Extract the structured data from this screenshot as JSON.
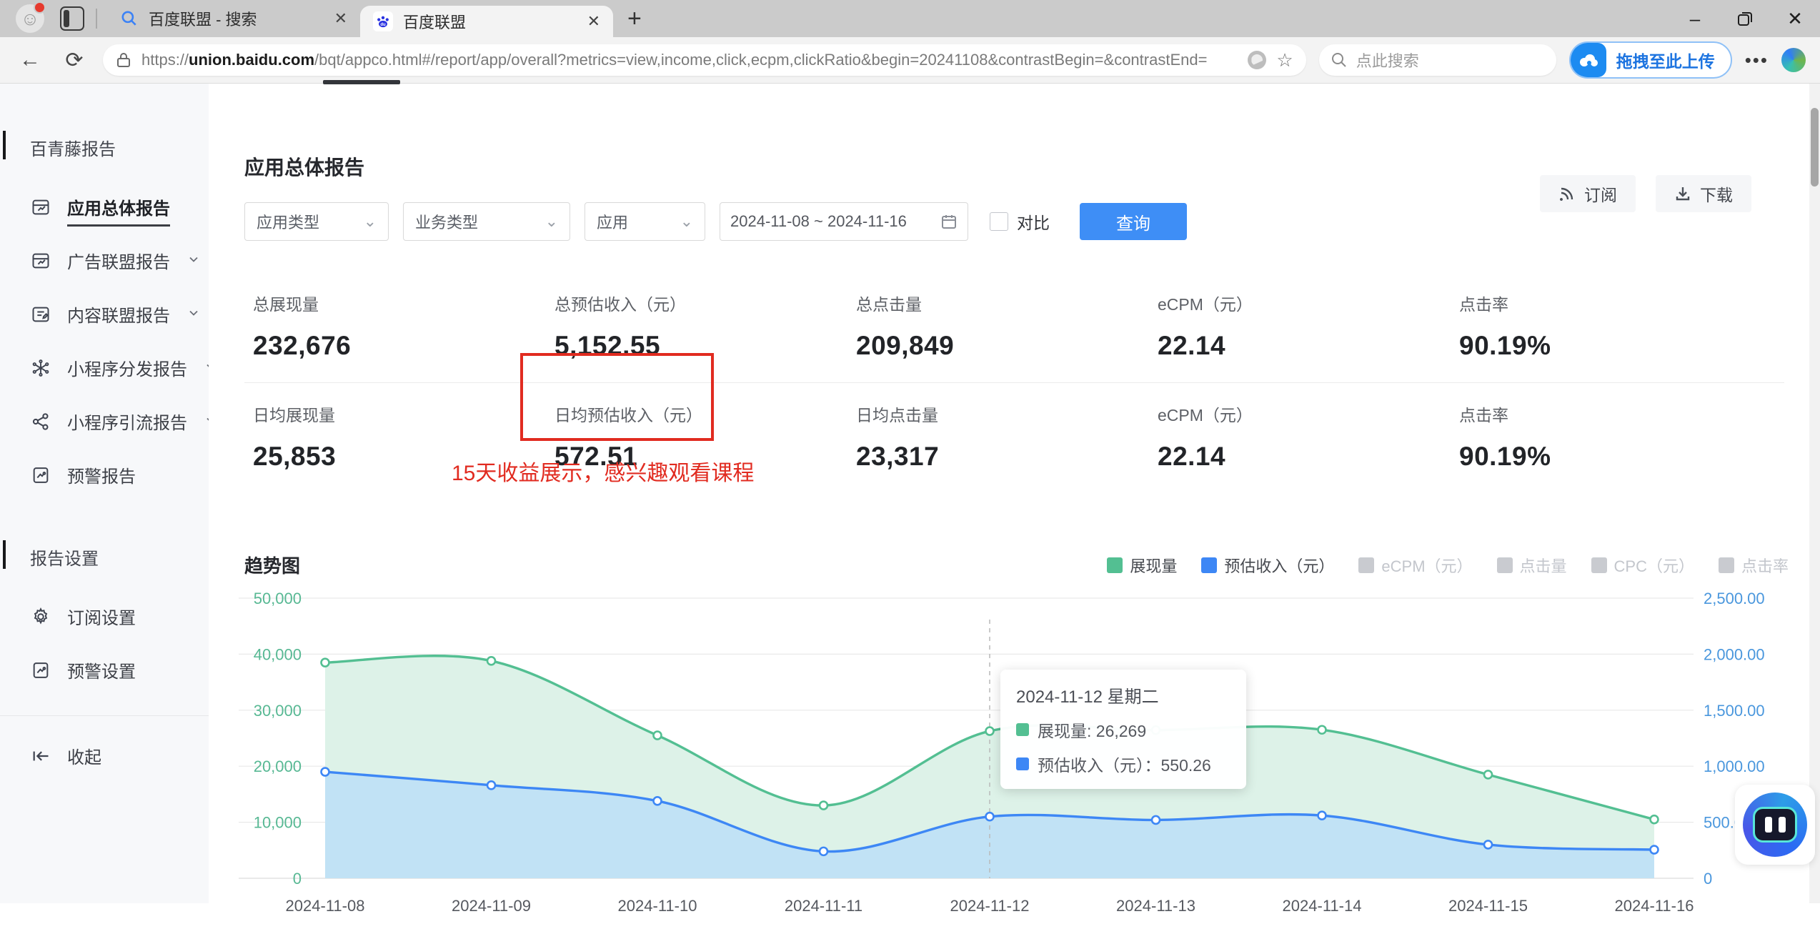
{
  "browser": {
    "tabs": [
      {
        "title": "百度联盟 - 搜索",
        "icon": "search-favicon",
        "active": false
      },
      {
        "title": "百度联盟",
        "icon": "baidu-favicon",
        "active": true
      }
    ],
    "url_prefix": "https://",
    "url_domain": "union.baidu.com",
    "url_path": "/bqt/appco.html#/report/app/overall?metrics=view,income,click,ecpm,clickRatio&begin=20241108&contrastBegin=&contrastEnd=",
    "search_placeholder": "点此搜索",
    "upload_button": "拖拽至此上传"
  },
  "sidebar": {
    "sections": [
      {
        "header": "百青藤报告",
        "items": [
          {
            "label": "应用总体报告",
            "icon": "report-icon",
            "active": true,
            "chevron": false
          },
          {
            "label": "广告联盟报告",
            "icon": "report-icon",
            "active": false,
            "chevron": true
          },
          {
            "label": "内容联盟报告",
            "icon": "content-icon",
            "active": false,
            "chevron": true
          },
          {
            "label": "小程序分发报告",
            "icon": "distribute-icon",
            "active": false,
            "chevron": true
          },
          {
            "label": "小程序引流报告",
            "icon": "share-icon",
            "active": false,
            "chevron": true
          },
          {
            "label": "预警报告",
            "icon": "alert-icon",
            "active": false,
            "chevron": false
          }
        ]
      },
      {
        "header": "报告设置",
        "items": [
          {
            "label": "订阅设置",
            "icon": "gear-icon",
            "active": false,
            "chevron": false
          },
          {
            "label": "预警设置",
            "icon": "alert-icon",
            "active": false,
            "chevron": false
          }
        ]
      }
    ],
    "collapse_label": "收起"
  },
  "page": {
    "title": "应用总体报告",
    "filters": {
      "app_type": "应用类型",
      "biz_type": "业务类型",
      "app": "应用",
      "date_range": "2024-11-08 ~ 2024-11-16",
      "compare_label": "对比",
      "query_button": "查询",
      "subscribe_button": "订阅",
      "download_button": "下载"
    },
    "stats_rows": [
      [
        {
          "label": "总展现量",
          "value": "232,676"
        },
        {
          "label": "总预估收入（元）",
          "value": "5,152.55"
        },
        {
          "label": "总点击量",
          "value": "209,849"
        },
        {
          "label": "eCPM（元）",
          "value": "22.14"
        },
        {
          "label": "点击率",
          "value": "90.19%"
        }
      ],
      [
        {
          "label": "日均展现量",
          "value": "25,853"
        },
        {
          "label": "日均预估收入（元）",
          "value": "572.51",
          "highlighted": true
        },
        {
          "label": "日均点击量",
          "value": "23,317"
        },
        {
          "label": "eCPM（元）",
          "value": "22.14"
        },
        {
          "label": "点击率",
          "value": "90.19%"
        }
      ]
    ],
    "annotation": "15天收益展示，感兴趣观看课程",
    "chart_title": "趋势图"
  },
  "colors": {
    "accent_blue": "#3e8ef6",
    "series_green": "#53bf92",
    "series_blue": "#3d87f5",
    "red_annotation": "#e12b20",
    "inactive_gray": "#c3c6cc"
  },
  "chart_data": {
    "type": "area",
    "x": [
      "2024-11-08",
      "2024-11-09",
      "2024-11-10",
      "2024-11-11",
      "2024-11-12",
      "2024-11-13",
      "2024-11-14",
      "2024-11-15",
      "2024-11-16"
    ],
    "series": [
      {
        "name": "展现量",
        "axis": "left",
        "color": "#53bf92",
        "fill": "#ddf2e8",
        "values": [
          38500,
          38800,
          25500,
          13000,
          26269,
          26450,
          26500,
          18500,
          10500
        ]
      },
      {
        "name": "预估收入（元）",
        "axis": "right",
        "color": "#3d87f5",
        "fill": "#bfe0f5",
        "values": [
          950,
          830,
          690,
          240,
          550.26,
          520,
          560,
          300,
          255
        ]
      }
    ],
    "legend": [
      {
        "label": "展现量",
        "color": "#53bf92",
        "active": true
      },
      {
        "label": "预估收入（元）",
        "color": "#3d87f5",
        "active": true
      },
      {
        "label": "eCPM（元）",
        "color": "#c9cbd0",
        "active": false
      },
      {
        "label": "点击量",
        "color": "#c9cbd0",
        "active": false
      },
      {
        "label": "CPC（元）",
        "color": "#c9cbd0",
        "active": false
      },
      {
        "label": "点击率",
        "color": "#c9cbd0",
        "active": false
      }
    ],
    "y_left": {
      "max": 50000,
      "ticks": [
        "0",
        "10,000",
        "20,000",
        "30,000",
        "40,000",
        "50,000"
      ],
      "color": "#57b893"
    },
    "y_right": {
      "max": 2500,
      "ticks": [
        "0",
        "500.00",
        "1,000.00",
        "1,500.00",
        "2,000.00",
        "2,500.00"
      ],
      "color": "#4a97dd"
    },
    "hover_index": 4,
    "grid": true,
    "legend_position": "top-right",
    "tooltip": {
      "date": "2024-11-12 星期二",
      "items": [
        {
          "text": "展现量: 26,269",
          "color": "#53bf92"
        },
        {
          "text": "预估收入（元）：550.26",
          "color": "#3d87f5"
        }
      ]
    }
  }
}
